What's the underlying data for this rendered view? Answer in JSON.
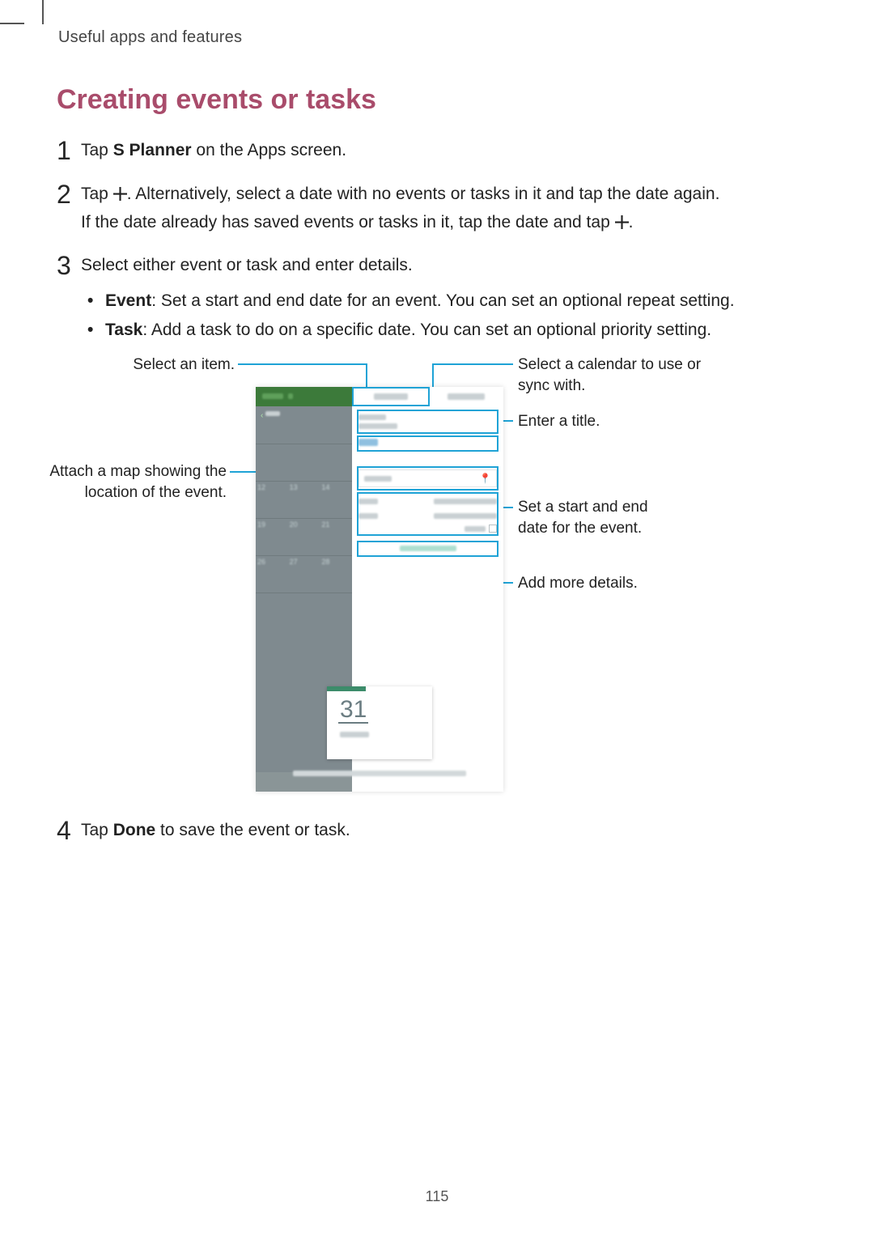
{
  "header": "Useful apps and features",
  "section_title": "Creating events or tasks",
  "steps": {
    "s1": {
      "num": "1",
      "pre": "Tap ",
      "bold": "S Planner",
      "post": " on the Apps screen."
    },
    "s2": {
      "num": "2",
      "line1a": "Tap ",
      "line1b": ". Alternatively, select a date with no events or tasks in it and tap the date again.",
      "line2a": "If the date already has saved events or tasks in it, tap the date and tap ",
      "line2b": "."
    },
    "s3": {
      "num": "3",
      "text": "Select either event or task and enter details."
    },
    "s4": {
      "num": "4",
      "pre": "Tap ",
      "bold": "Done",
      "post": " to save the event or task."
    }
  },
  "bullets": {
    "b1": {
      "bold": "Event",
      "text": ": Set a start and end date for an event. You can set an optional repeat setting."
    },
    "b2": {
      "bold": "Task",
      "text": ": Add a task to do on a specific date. You can set an optional priority setting."
    }
  },
  "callouts": {
    "select_item": "Select an item.",
    "attach_map_l1": "Attach a map showing the",
    "attach_map_l2": "location of the event.",
    "select_cal_l1": "Select a calendar to use or",
    "select_cal_l2": "sync with.",
    "enter_title": "Enter a title.",
    "set_dates_l1": "Set a start and end",
    "set_dates_l2": "date for the event.",
    "add_more": "Add more details."
  },
  "device": {
    "big_day": "31",
    "cal_back": "‹",
    "pin": "📍",
    "day_headers": [
      "",
      "",
      ""
    ],
    "weeks": [
      [
        "",
        "",
        ""
      ],
      [
        "12",
        "13",
        "14"
      ],
      [
        "19",
        "20",
        "21"
      ],
      [
        "26",
        "27",
        "28"
      ],
      [
        "",
        "",
        ""
      ]
    ]
  },
  "page_number": "115"
}
